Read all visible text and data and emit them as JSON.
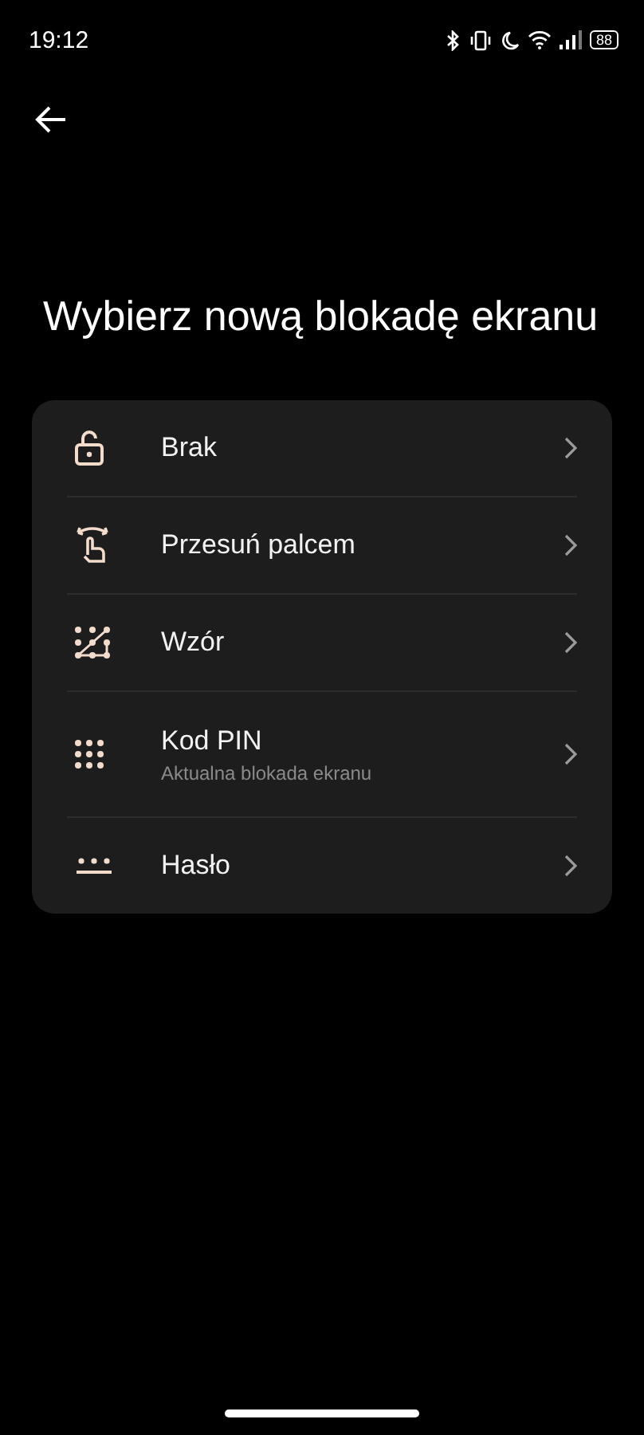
{
  "status_bar": {
    "time": "19:12",
    "battery": "88"
  },
  "title": "Wybierz nową blokadę ekranu",
  "options": [
    {
      "kind": "none",
      "label": "Brak"
    },
    {
      "kind": "swipe",
      "label": "Przesuń palcem"
    },
    {
      "kind": "pattern",
      "label": "Wzór"
    },
    {
      "kind": "pin",
      "label": "Kod PIN",
      "subtitle": "Aktualna blokada ekranu"
    },
    {
      "kind": "password",
      "label": "Hasło"
    }
  ]
}
